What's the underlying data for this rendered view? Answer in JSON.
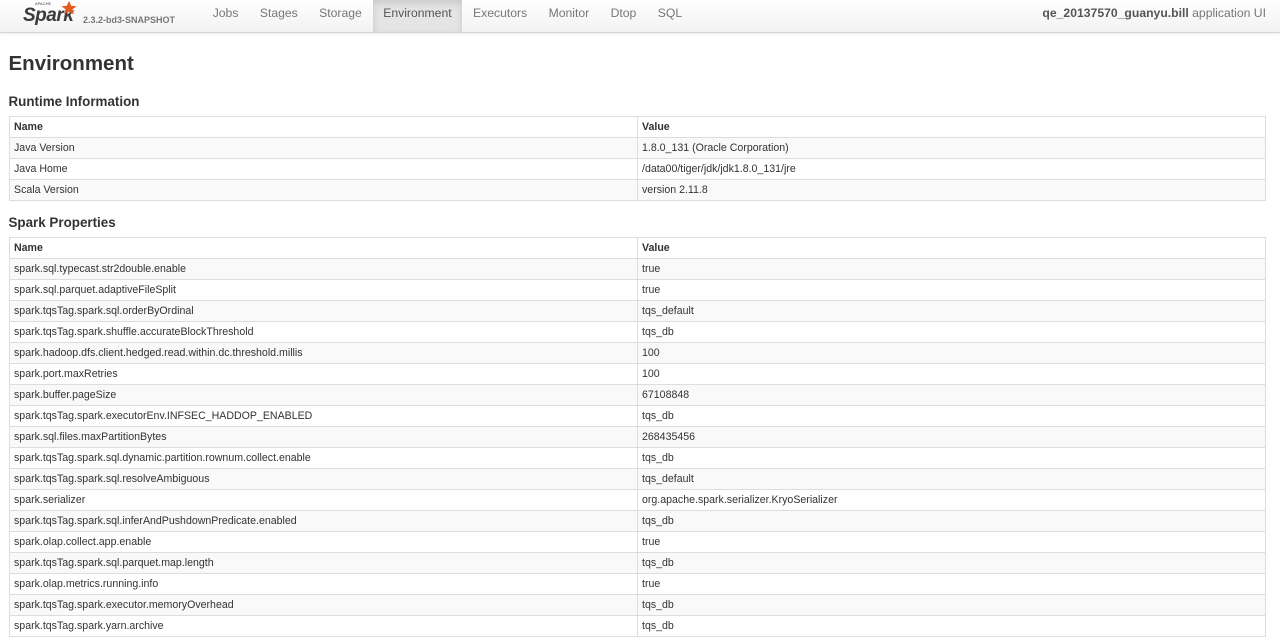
{
  "nav": {
    "version": "2.3.2-bd3-SNAPSHOT",
    "items": [
      "Jobs",
      "Stages",
      "Storage",
      "Environment",
      "Executors",
      "Monitor",
      "Dtop",
      "SQL"
    ],
    "active": "Environment",
    "app_name": "qe_20137570_guanyu.bill",
    "app_suffix": "application UI"
  },
  "page_title": "Environment",
  "runtime": {
    "title": "Runtime Information",
    "headers": [
      "Name",
      "Value"
    ],
    "rows": [
      [
        "Java Version",
        "1.8.0_131 (Oracle Corporation)"
      ],
      [
        "Java Home",
        "/data00/tiger/jdk/jdk1.8.0_131/jre"
      ],
      [
        "Scala Version",
        "version 2.11.8"
      ]
    ]
  },
  "spark_props": {
    "title": "Spark Properties",
    "headers": [
      "Name",
      "Value"
    ],
    "rows": [
      [
        "spark.sql.typecast.str2double.enable",
        "true"
      ],
      [
        "spark.sql.parquet.adaptiveFileSplit",
        "true"
      ],
      [
        "spark.tqsTag.spark.sql.orderByOrdinal",
        "tqs_default"
      ],
      [
        "spark.tqsTag.spark.shuffle.accurateBlockThreshold",
        "tqs_db"
      ],
      [
        "spark.hadoop.dfs.client.hedged.read.within.dc.threshold.millis",
        "100"
      ],
      [
        "spark.port.maxRetries",
        "100"
      ],
      [
        "spark.buffer.pageSize",
        "67108848"
      ],
      [
        "spark.tqsTag.spark.executorEnv.INFSEC_HADDOP_ENABLED",
        "tqs_db"
      ],
      [
        "spark.sql.files.maxPartitionBytes",
        "268435456"
      ],
      [
        "spark.tqsTag.spark.sql.dynamic.partition.rownum.collect.enable",
        "tqs_db"
      ],
      [
        "spark.tqsTag.spark.sql.resolveAmbiguous",
        "tqs_default"
      ],
      [
        "spark.serializer",
        "org.apache.spark.serializer.KryoSerializer"
      ],
      [
        "spark.tqsTag.spark.sql.inferAndPushdownPredicate.enabled",
        "tqs_db"
      ],
      [
        "spark.olap.collect.app.enable",
        "true"
      ],
      [
        "spark.tqsTag.spark.sql.parquet.map.length",
        "tqs_db"
      ],
      [
        "spark.olap.metrics.running.info",
        "true"
      ],
      [
        "spark.tqsTag.spark.executor.memoryOverhead",
        "tqs_db"
      ],
      [
        "spark.tqsTag.spark.yarn.archive",
        "tqs_db"
      ]
    ]
  },
  "colors": {
    "spark_orange": "#e25a1c",
    "spark_gray": "#3c3a3e",
    "stripe": "#f9f9f9",
    "border": "#dddddd"
  }
}
